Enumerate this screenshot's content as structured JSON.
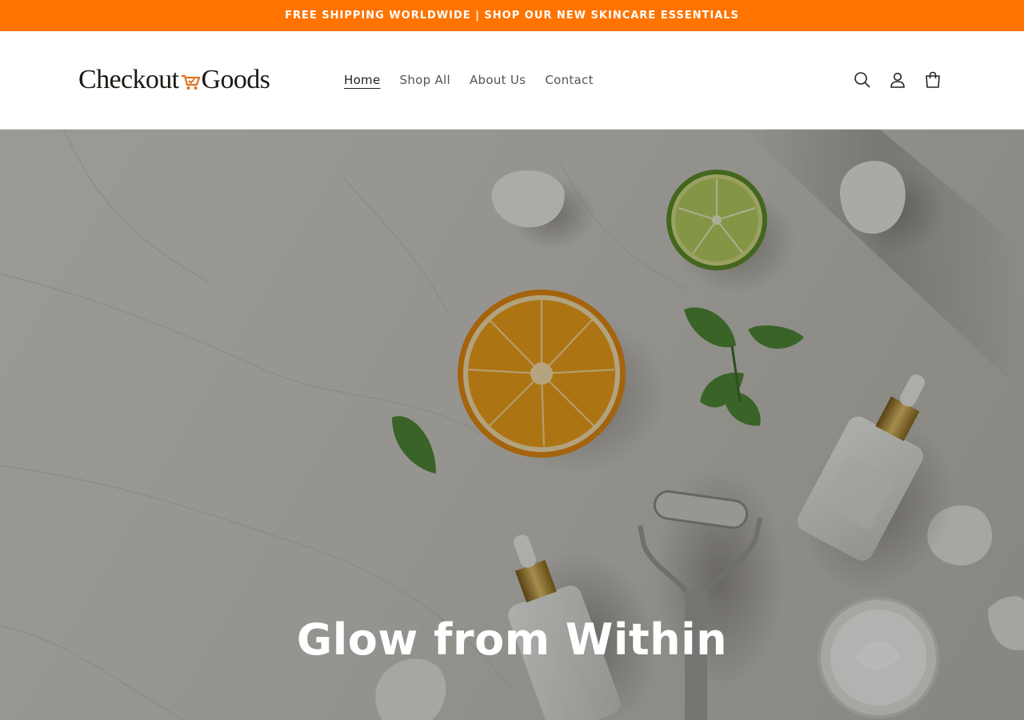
{
  "announcement": {
    "text": "FREE SHIPPING WORLDWIDE | SHOP OUR NEW SKINCARE ESSENTIALS"
  },
  "brand": {
    "name_part1": "Checkout",
    "name_part2": "Goods",
    "accent_color": "#ff7300",
    "text_color": "#1d1915"
  },
  "nav": {
    "items": [
      {
        "label": "Home",
        "active": true
      },
      {
        "label": "Shop All",
        "active": false
      },
      {
        "label": "About Us",
        "active": false
      },
      {
        "label": "Contact",
        "active": false
      }
    ]
  },
  "header_icons": [
    "search-icon",
    "account-icon",
    "cart-icon"
  ],
  "hero": {
    "title": "Glow from Within",
    "overlay_color": "rgba(0,0,0,0.28)",
    "image_subject": [
      "orange-slice",
      "lime-slice",
      "mint-leaves",
      "serum-bottle",
      "dropper-bottle",
      "face-roller",
      "cream-jar",
      "eggshells"
    ]
  }
}
